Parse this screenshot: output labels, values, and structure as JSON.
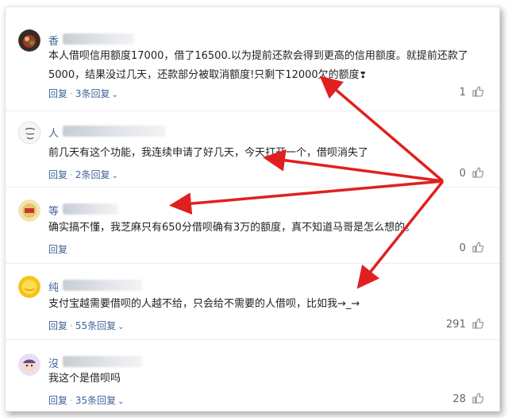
{
  "colors": {
    "accent": "#406599",
    "arrow": "#e02020"
  },
  "comments": [
    {
      "username": "香",
      "avatar_icon": "avatar-food-icon",
      "text": "本人借呗信用额度17000，借了16500.以为提前还款会得到更高的信用额度。就提前还款了5000，结果没过几天，还款部分被取消额度!只剩下12000欠的额度",
      "emoji": "❣",
      "reply_label": "回复",
      "replies_label": "3条回复",
      "likes": "1"
    },
    {
      "username": "人",
      "avatar_icon": "avatar-sketch-icon",
      "text": "前几天有这个功能，我连续申请了好几天，今天打开一个，借呗消失了",
      "reply_label": "回复",
      "replies_label": "2条回复",
      "likes": "0"
    },
    {
      "username": "等",
      "avatar_icon": "avatar-badge-icon",
      "text": "确实搞不懂，我芝麻只有650分借呗确有3万的额度，真不知道马哥是怎么想的。",
      "reply_label": "回复",
      "likes": "0"
    },
    {
      "username": "纯",
      "avatar_icon": "avatar-yellow-icon",
      "text": "支付宝越需要借呗的人越不给，只会给不需要的人借呗，比如我→_→",
      "reply_label": "回复",
      "replies_label": "55条回复",
      "likes": "291"
    },
    {
      "username": "沒",
      "avatar_icon": "avatar-cartoon-icon",
      "text": "我这个是借呗吗",
      "reply_label": "回复",
      "replies_label": "35条回复",
      "likes": "28"
    }
  ]
}
